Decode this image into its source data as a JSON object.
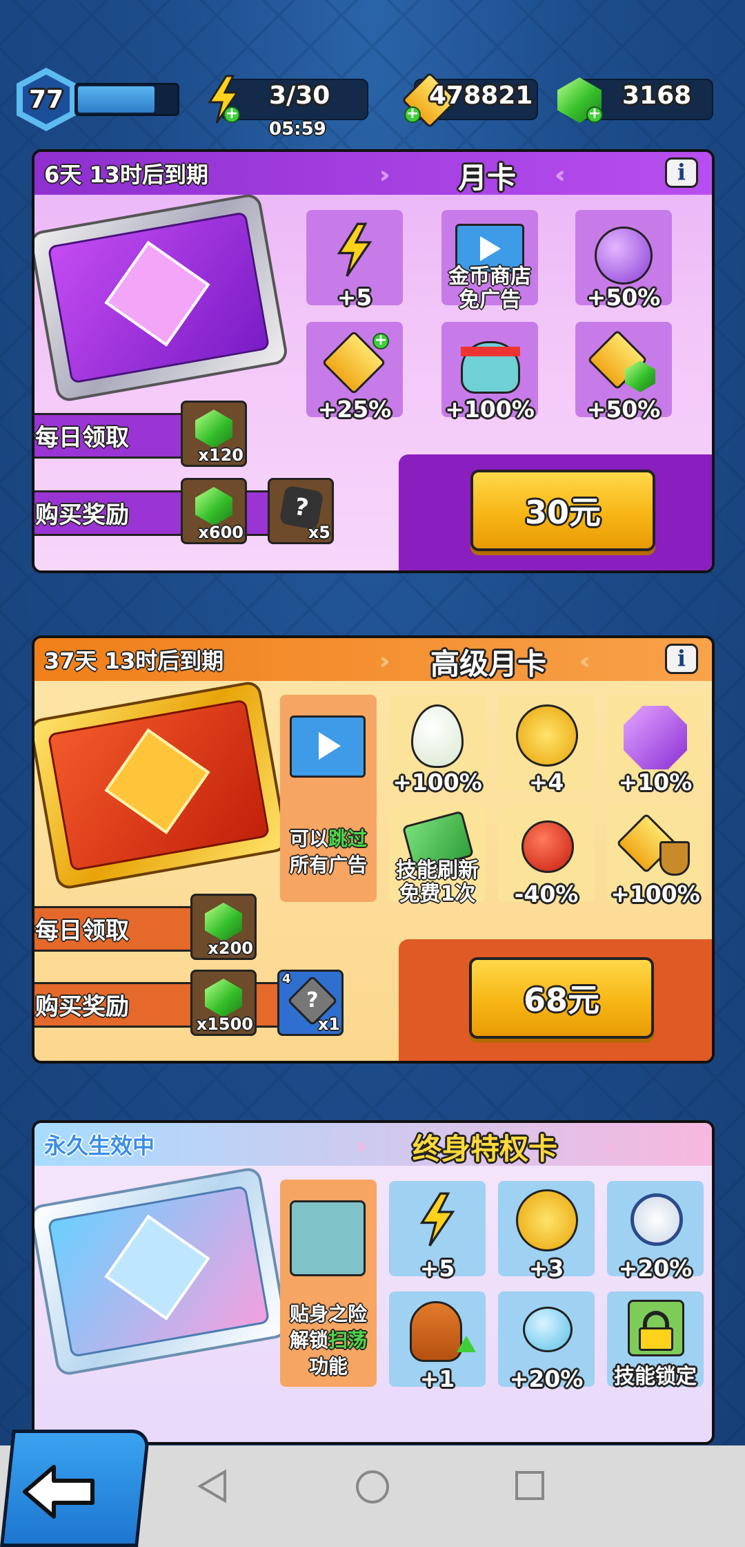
{
  "topbar": {
    "level": "77",
    "energy": "3/30",
    "energy_timer": "05:59",
    "coins": "478821",
    "gems": "3168",
    "xp_fraction": 0.76
  },
  "monthly": {
    "expire": "6天 13时后到期",
    "title": "月卡",
    "perks": [
      {
        "label": "+5"
      },
      {
        "label": "金币商店\n免广告"
      },
      {
        "label": "+50%"
      },
      {
        "label": "+25%"
      },
      {
        "label": "+100%"
      },
      {
        "label": "+50%"
      }
    ],
    "daily_label": "每日领取",
    "daily_reward": "x120",
    "buy_label": "购买奖励",
    "buy_reward1": "x600",
    "buy_reward2": "x5",
    "price": "30元"
  },
  "premium": {
    "expire": "37天 13时后到期",
    "title": "高级月卡",
    "ad_text1": "可以",
    "ad_text_hl": "跳过",
    "ad_text2": "所有广告",
    "perks": [
      {
        "label": "+100%"
      },
      {
        "label": "+4"
      },
      {
        "label": "+10%"
      },
      {
        "label": "技能刷新\n免费1次"
      },
      {
        "label": "-40%"
      },
      {
        "label": "+100%"
      }
    ],
    "daily_label": "每日领取",
    "daily_reward": "x200",
    "buy_label": "购买奖励",
    "buy_reward1": "x1500",
    "buy_reward2": "x1",
    "buy_reward2_badge": "4",
    "price": "68元"
  },
  "lifetime": {
    "status": "永久生效中",
    "title": "终身特权卡",
    "side_text1": "贴身之险",
    "side_text2a": "解锁",
    "side_text_hl": "扫荡",
    "side_text3": "功能",
    "perks": [
      {
        "label": "+5"
      },
      {
        "label": "+3"
      },
      {
        "label": "+20%"
      },
      {
        "label": "+1"
      },
      {
        "label": "+20%"
      },
      {
        "label": "技能锁定"
      }
    ]
  },
  "colors": {
    "monthly": "#a53bd8",
    "premium": "#f08a1e",
    "lifetime": "#5ab3ee",
    "price_btn": "#f7b615"
  }
}
